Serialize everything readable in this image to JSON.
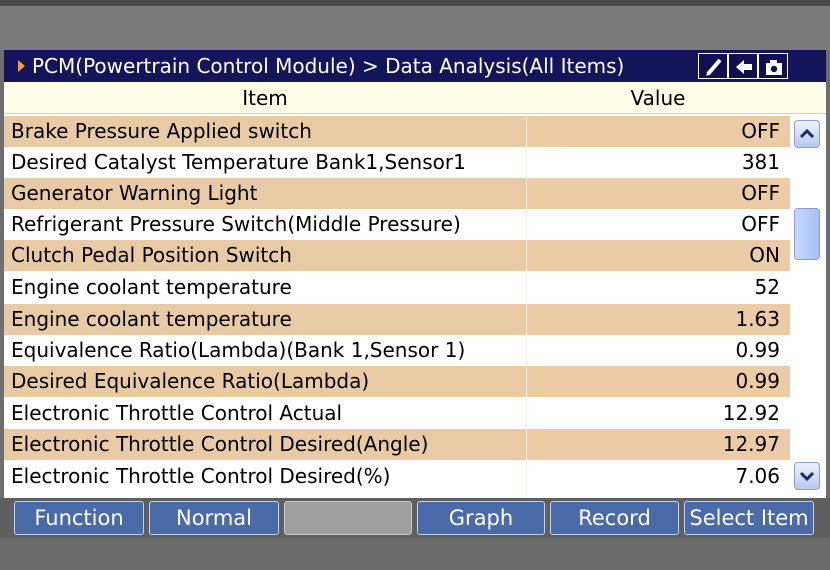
{
  "titlebar": {
    "title": "PCM(Powertrain Control Module) > Data Analysis(All Items)",
    "buttons": [
      {
        "icon": "pen-icon"
      },
      {
        "icon": "back-arrow-icon"
      },
      {
        "icon": "camera-icon"
      }
    ]
  },
  "header": {
    "item": "Item",
    "value": "Value"
  },
  "rows": [
    {
      "name": "Brake Pressure Applied switch",
      "value": "OFF"
    },
    {
      "name": "Desired Catalyst Temperature Bank1,Sensor1",
      "value": "381"
    },
    {
      "name": "Generator Warning Light",
      "value": "OFF"
    },
    {
      "name": "Refrigerant Pressure Switch(Middle Pressure)",
      "value": "OFF"
    },
    {
      "name": "Clutch Pedal Position Switch",
      "value": "ON"
    },
    {
      "name": "Engine coolant temperature",
      "value": "52"
    },
    {
      "name": "Engine coolant temperature",
      "value": "1.63"
    },
    {
      "name": "Equivalence Ratio(Lambda)(Bank 1,Sensor 1)",
      "value": "0.99"
    },
    {
      "name": "Desired Equivalence Ratio(Lambda)",
      "value": "0.99"
    },
    {
      "name": "Electronic Throttle Control Actual",
      "value": "12.92"
    },
    {
      "name": "Electronic Throttle Control Desired(Angle)",
      "value": "12.97"
    },
    {
      "name": "Electronic Throttle Control Desired(%)",
      "value": "7.06"
    }
  ],
  "footer": {
    "buttons": [
      "Function",
      "Normal",
      "",
      "Graph",
      "Record",
      "Select Item"
    ]
  },
  "colors": {
    "titlebar": "#14145a",
    "row_highlight": "#e8cba5",
    "button": "#4a6aa8"
  }
}
